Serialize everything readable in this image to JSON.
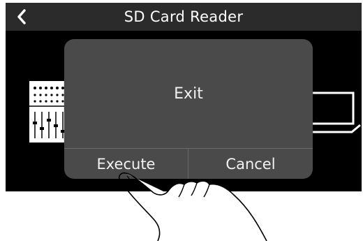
{
  "header": {
    "title": "SD Card Reader",
    "back_icon": "chevron-left-icon"
  },
  "dialog": {
    "message": "Exit",
    "buttons": {
      "execute_label": "Execute",
      "cancel_label": "Cancel"
    }
  },
  "illustrations": {
    "left": "mixer-device-icon",
    "right": "laptop-icon",
    "overlay": "pointing-hand-icon"
  },
  "colors": {
    "screen_background": "#000000",
    "header_background": "#2b2b2b",
    "dialog_background": "#4a4a4a",
    "text": "#ffffff"
  }
}
